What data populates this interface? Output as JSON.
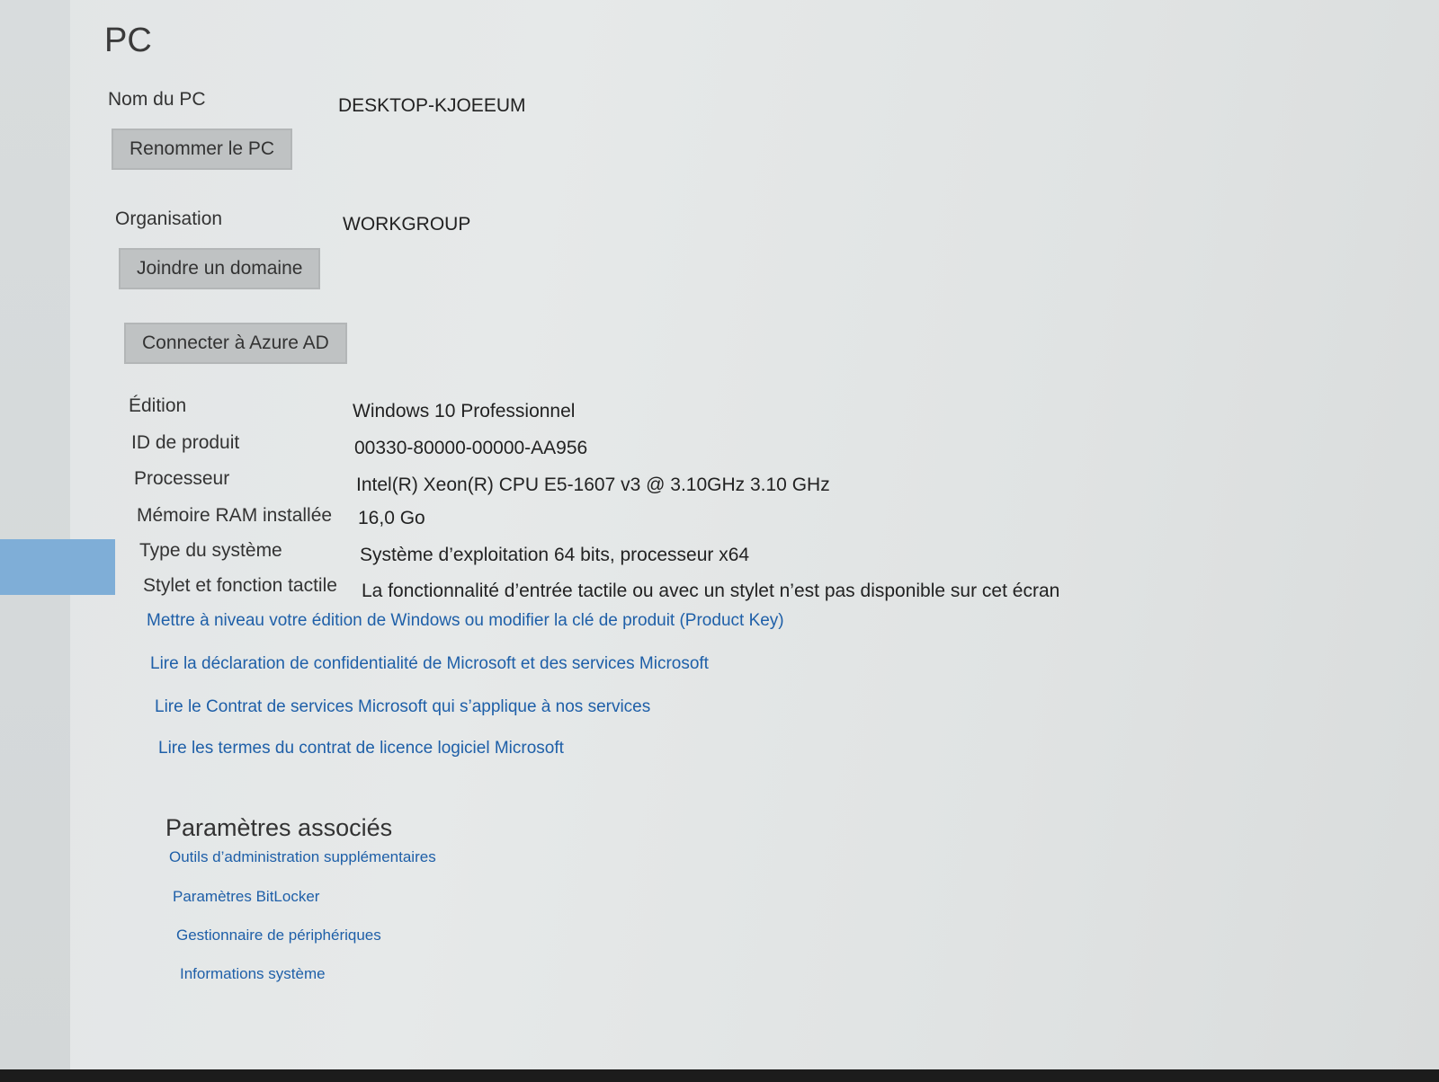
{
  "page": {
    "title": "PC"
  },
  "pc_name": {
    "label": "Nom du PC",
    "value": "DESKTOP-KJOEEUM",
    "rename_button": "Renommer le PC"
  },
  "organisation": {
    "label": "Organisation",
    "value": "WORKGROUP",
    "join_button": "Joindre un domaine",
    "azure_button": "Connecter à Azure AD"
  },
  "specs": [
    {
      "label": "Édition",
      "value": "Windows 10 Professionnel"
    },
    {
      "label": "ID de produit",
      "value": "00330-80000-00000-AA956"
    },
    {
      "label": "Processeur",
      "value": "Intel(R) Xeon(R) CPU E5-1607 v3 @ 3.10GHz   3.10 GHz"
    },
    {
      "label": "Mémoire RAM installée",
      "value": "16,0 Go"
    },
    {
      "label": "Type du système",
      "value": "Système d’exploitation 64 bits, processeur x64"
    },
    {
      "label": "Stylet et fonction tactile",
      "value": "La fonctionnalité d’entrée tactile ou avec un stylet n’est pas disponible sur cet écran"
    }
  ],
  "links": [
    "Mettre à niveau votre édition de Windows ou modifier la clé de produit (Product Key)",
    "Lire la déclaration de confidentialité de Microsoft et des services Microsoft",
    "Lire le Contrat de services Microsoft qui s’applique à nos services",
    "Lire les termes du contrat de licence logiciel Microsoft"
  ],
  "related": {
    "title": "Paramètres associés",
    "links": [
      "Outils d’administration supplémentaires",
      "Paramètres BitLocker",
      "Gestionnaire de périphériques",
      "Informations système"
    ]
  },
  "colors": {
    "link": "#1e5fa8",
    "nav_selected": "#7faed7",
    "button": "#bfc2c3"
  }
}
